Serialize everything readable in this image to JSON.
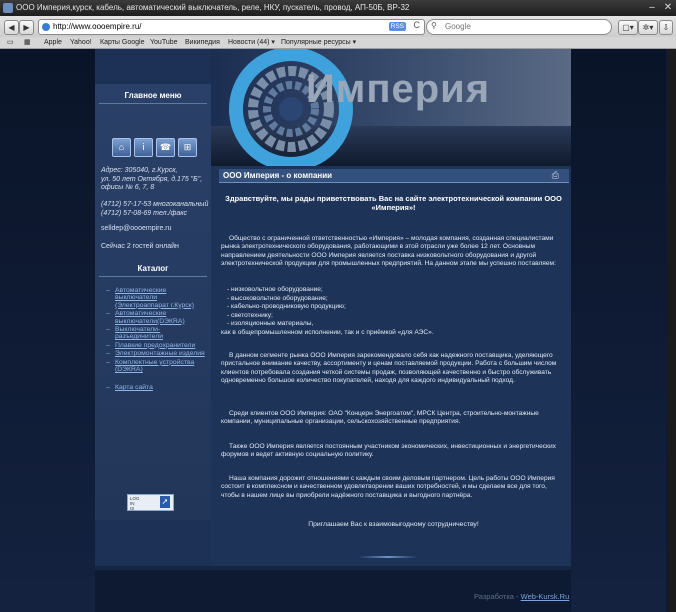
{
  "window": {
    "title": "ООО Империя,курск, кабель, автоматический выключатель, реле, НКУ, пускатель, провод, АП-50Б, ВР-32"
  },
  "toolbar": {
    "back": "◀",
    "forward": "▶",
    "add": "+",
    "url": "http://www.oooempire.ru/",
    "rss": "RSS",
    "reload": "C",
    "search_placeholder": "Google",
    "page_menu": "▢▾",
    "gear_menu": "✲▾"
  },
  "bookmarks": {
    "items": [
      "Apple",
      "Yahoo!",
      "Карты Google",
      "YouTube",
      "Википедия",
      "Новости (44) ▾",
      "Популярные ресурсы ▾"
    ]
  },
  "header": {
    "brand": "Империя"
  },
  "sidebar": {
    "main_menu_title": "Главное меню",
    "address": [
      "Адрес: 305040, г.Курск,",
      "ул. 50 лет Октября, д.175 \"Б\",",
      "офисы № 6, 7, 8"
    ],
    "phones": [
      "(4712) 57-17-53 многоканальный",
      "(4712) 57-08-69 тел./факс"
    ],
    "email": "selldep@oooempire.ru",
    "online": "Сейчас 2 гостей онлайн",
    "catalog_title": "Каталог",
    "catalog": [
      "Автоматические выключатели (Электроаппарат г.Курск)",
      "Автоматические выключатели(DЭКRА)",
      "Выключатели-разъединители",
      "Плавкие предохранители",
      "Электромонтажные изделия",
      "Комплектные устройства (DЭКRА)"
    ],
    "sitemap": "Карта сайта",
    "counter_text": [
      "LOG",
      "IN",
      "IS"
    ]
  },
  "content": {
    "title": "ООО Империя - о компании",
    "greeting": "Здравствуйте, мы рады приветствовать Вас на сайте электротехнической компании ООО «Империя»!",
    "p1": "Общество с ограниченной ответственностью «Империя» – молодая компания, созданная специалистами рынка электротехнического оборудования, работающими в этой отрасли уже более 12 лет. Основным направлением деятельности ООО Империя является поставка низковольтного оборудования и другой электротехнической продукции для промышленных предприятий. На данном этапе мы успешно поставляем:",
    "list": [
      "- низковольтное оборудование;",
      "- высоковольтное оборудование;",
      "- кабельно-проводниковую продукцию;",
      "- светотехнику;",
      "- изоляционные материалы,"
    ],
    "list_tail": "как в общепромышленном исполнении, так и с приёмкой «для АЭС».",
    "p2": "В данном сегменте рынка ООО Империя зарекомендовало себя как надежного поставщика, уделяющего пристальное внимание качеству, ассортименту и ценам поставляемой продукции. Работа с большим числом клиентов потребовала создания четкой системы продаж, позволяющей качественно и быстро обслуживать одновременно большое количество покупателей, находя для каждого индивидуальный подход.",
    "p3": "Среди клиентов ООО Империя: ОАО \"Концерн Энергоатом\", МРСК Центра, строительно-монтажные компании, муниципальные организации, сельскохозяйственные предприятия.",
    "p4": "Также ООО Империя является постоянным участником экономических, инвестиционных и энергетических форумов и ведет активную социальную политику.",
    "p5": "Наша компания дорожит отношениями с каждым своим деловым партнером. Цель работы ООО Империя состоит в комплексном и качественном удовлетворении ваших потребностей, и мы сделаем все для того, чтобы в нашем лице вы приобрели надёжного поставщика и выгодного партнёра.",
    "closing": "Приглашаем Вас к взаимовыгодному сотрудничеству!"
  },
  "footer": {
    "label": "Разработка - ",
    "link": "Web-Kursk.Ru"
  }
}
